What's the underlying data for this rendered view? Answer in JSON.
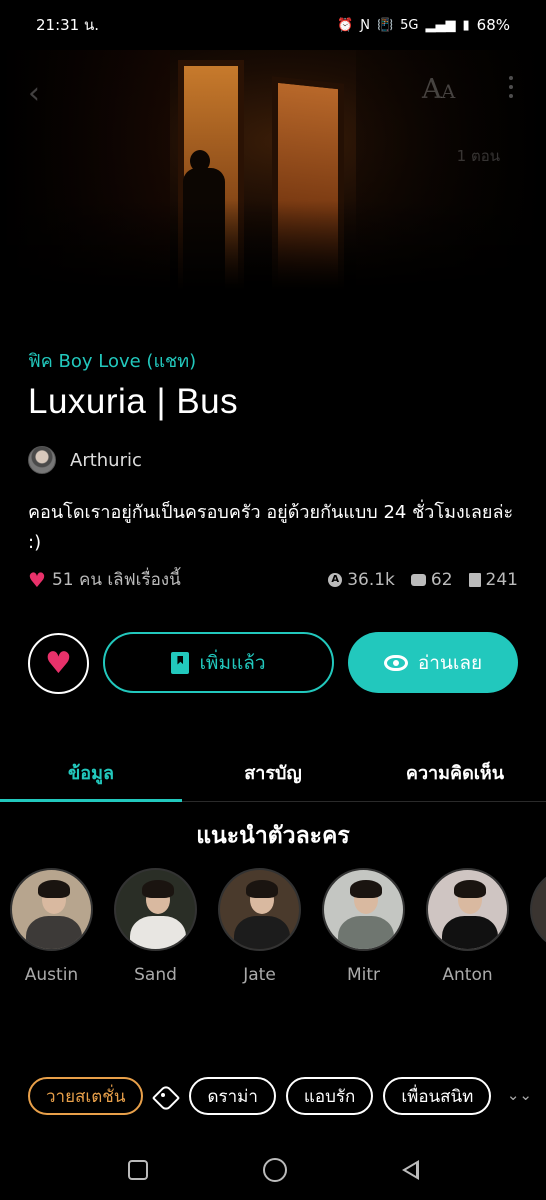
{
  "status_bar": {
    "time": "21:31 น.",
    "network": "5G",
    "battery": "68%"
  },
  "header": {
    "font_button": "Aa",
    "episode_count": "1 ตอน"
  },
  "story": {
    "category": "ฟิค Boy Love (แชท)",
    "title": "Luxuria | Bus",
    "author": "Arthuric",
    "synopsis": "คอนโดเราอยู่กันเป็นครอบครัว อยู่ด้วยกันแบบ 24 ชั่วโมงเลยล่ะ :)",
    "likes_text": "51 คน เลิฟเรื่องนี้",
    "views": "36.1k",
    "comments": "62",
    "chapters": "241"
  },
  "actions": {
    "added_label": "เพิ่มแล้ว",
    "read_label": "อ่านเลย"
  },
  "tabs": [
    {
      "label": "ข้อมูล",
      "active": true
    },
    {
      "label": "สารบัญ",
      "active": false
    },
    {
      "label": "ความคิดเห็น",
      "active": false
    }
  ],
  "characters_section": {
    "title": "แนะนำตัวละคร",
    "characters": [
      {
        "name": "Austin"
      },
      {
        "name": "Sand"
      },
      {
        "name": "Jate"
      },
      {
        "name": "Mitr"
      },
      {
        "name": "Anton"
      }
    ]
  },
  "tags": {
    "age_rating": "วายสเตชั่น",
    "items": [
      "ดราม่า",
      "แอบรัก",
      "เพื่อนสนิท"
    ]
  },
  "colors": {
    "accent": "#22c8bd",
    "heart": "#e8316a",
    "age_tag": "#e8a04a",
    "background": "#000000"
  }
}
